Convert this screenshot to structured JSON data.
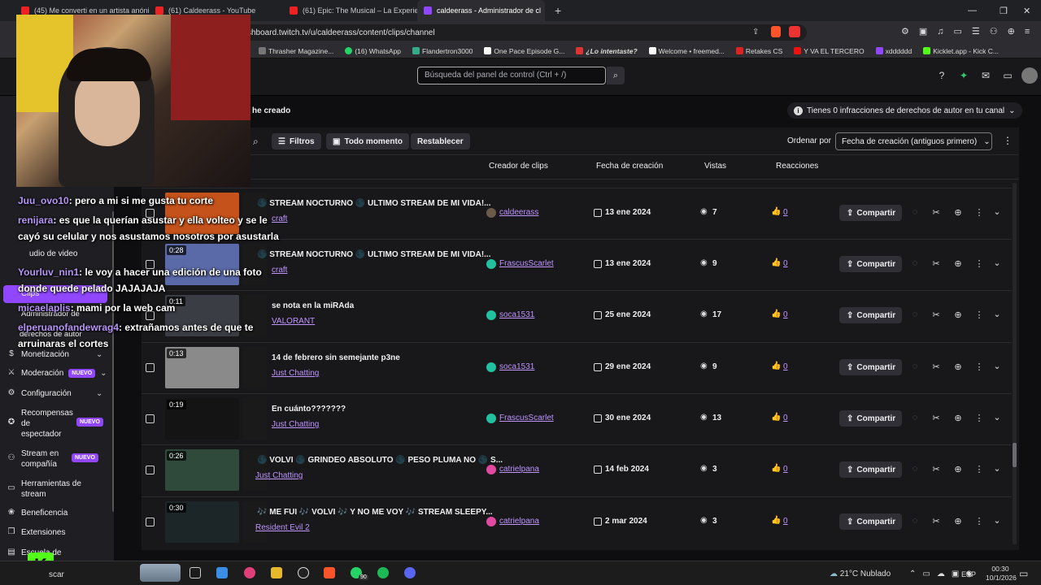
{
  "browser": {
    "tabs": [
      {
        "title": "(45) Me converti en un artista anónim"
      },
      {
        "title": "(61) Caldeerass - YouTube"
      },
      {
        "title": "(61) Epic: The Musical – La Experienc"
      },
      {
        "title": "caldeerass - Administrador de cl",
        "active": true
      }
    ],
    "url": "shboard.twitch.tv/u/caldeerass/content/clips/channel",
    "bookmarks": [
      "Thrasher Magazine...",
      "(16) WhatsApp",
      "Flandertron3000",
      "One Pace Episode G...",
      "¿Lo intentaste?",
      "Welcome • freemed...",
      "Retakes CS",
      "Y VA EL TERCERO",
      "xdddddd",
      "Kicklet.app - Kick C..."
    ]
  },
  "header": {
    "search_placeholder": "Búsqueda del panel de control (Ctrl + /)"
  },
  "page": {
    "tab_label": "he creado",
    "copyright_notice": "Tienes 0 infracciones de derechos de autor en tu canal",
    "filters_label": "Filtros",
    "time_label": "Todo momento",
    "reset_label": "Restablecer",
    "sort_label": "Ordenar por",
    "sort_value": "Fecha de creación (antiguos primero)",
    "share_label": "Compartir"
  },
  "columns": {
    "creator": "Creador de clips",
    "date": "Fecha de creación",
    "views": "Vistas",
    "reactions": "Reacciones"
  },
  "sidebar": {
    "items": [
      {
        "label": "Monetización"
      },
      {
        "label": "Moderación",
        "badge": "NUEVO"
      },
      {
        "label": "Configuración"
      },
      {
        "label": "Recompensas de espectador",
        "badge": "NUEVO"
      },
      {
        "label": "Stream en compañía",
        "badge": "NUEVO"
      },
      {
        "label": "Herramientas de stream"
      },
      {
        "label": "Beneficencia"
      },
      {
        "label": "Extensiones"
      },
      {
        "label": "Escuela de"
      }
    ],
    "partial": [
      "udio de video",
      "Clips",
      "Administrador de",
      "derechos de autor"
    ]
  },
  "clips": [
    {
      "duration": "",
      "title": "🌑 STREAM NOCTURNO 🌑 ULTIMO STREAM DE MI VIDA!...",
      "category": "craft",
      "creator": "caldeerass",
      "date": "13 ene 2024",
      "views": "7",
      "reactions": "0",
      "thumb": "#c4521a"
    },
    {
      "duration": "0:28",
      "title": "🌑 STREAM NOCTURNO 🌑 ULTIMO STREAM DE MI VIDA!...",
      "category": "craft",
      "creator": "FrascusScarlet",
      "date": "13 ene 2024",
      "views": "9",
      "reactions": "0",
      "thumb": "#5a6aa8"
    },
    {
      "duration": "0:11",
      "title": "se nota en la miRAda",
      "category": "VALORANT",
      "creator": "soca1531",
      "date": "25 ene 2024",
      "views": "17",
      "reactions": "0",
      "thumb": "#3a3e44"
    },
    {
      "duration": "0:13",
      "title": "14 de febrero sin semejante p3ne",
      "category": "Just Chatting",
      "creator": "soca1531",
      "date": "29 ene 2024",
      "views": "9",
      "reactions": "0",
      "thumb": "#8a8a8a"
    },
    {
      "duration": "0:19",
      "title": "En cuánto???????",
      "category": "Just Chatting",
      "creator": "FrascusScarlet",
      "date": "30 ene 2024",
      "views": "13",
      "reactions": "0",
      "thumb": "#141414"
    },
    {
      "duration": "0:26",
      "title": "🌑 VOLVI 🌑 GRINDEO ABSOLUTO 🌑 PESO PLUMA NO 🌑 S...",
      "category": "Just Chatting",
      "creator": "catrielpana",
      "date": "14 feb 2024",
      "views": "3",
      "reactions": "0",
      "thumb": "#2f4a3a"
    },
    {
      "duration": "0:30",
      "title": "🎶 ME FUI 🎶 VOLVI 🎶 Y NO ME VOY 🎶 STREAM SLEEPY...",
      "category": "Resident Evil 2",
      "creator": "catrielpana",
      "date": "2 mar 2024",
      "views": "3",
      "reactions": "0",
      "thumb": "#1c2628"
    }
  ],
  "chat": [
    {
      "user": "Juu_ovo10",
      "text": ": pero a mi si me gusta tu corte"
    },
    {
      "user": "renijara",
      "text": ": es que la querían asustar y ella volteo y se le"
    },
    {
      "user": "",
      "text": "cayó su celular y nos asustamos nosotros por asustarla"
    },
    {
      "user": "Yourluv_nin1",
      "text": ": le voy a hacer una edición de una foto"
    },
    {
      "user": "",
      "text": "donde quede pelado JAJAJAJA"
    },
    {
      "user": "micaelaplis",
      "text": ": mami por la web cam"
    },
    {
      "user": "elperuanofandewrag4",
      "text": ": extrañamos antes de que te"
    },
    {
      "user": "",
      "text": "arruinaras el cortes"
    }
  ],
  "taskbar": {
    "search": "scar",
    "weather": "21°C  Nublado",
    "lang": "ESP",
    "time": "00:30",
    "date": "10/1/2026",
    "badge": "90"
  }
}
